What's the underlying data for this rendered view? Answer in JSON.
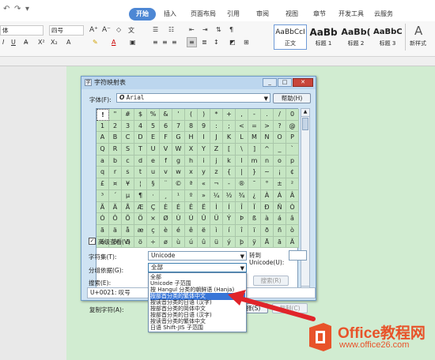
{
  "ribbon": {
    "tabs": [
      {
        "label": "开始",
        "active": true
      },
      {
        "label": "插入"
      },
      {
        "label": "页面布局"
      },
      {
        "label": "引用"
      },
      {
        "label": "审阅"
      },
      {
        "label": "视图"
      },
      {
        "label": "章节"
      },
      {
        "label": "开发工具"
      },
      {
        "label": "云服务"
      }
    ],
    "font_name": "体",
    "font_size": "四号",
    "styles": [
      {
        "preview": "AaBbCcI",
        "label": "正文"
      },
      {
        "preview": "AaBb",
        "label": "标题 1"
      },
      {
        "preview": "AaBb(",
        "label": "标题 2"
      },
      {
        "preview": "AaBbC",
        "label": "标题 3"
      }
    ],
    "new_style_label": "新样式"
  },
  "dialog": {
    "title": "字符映射表",
    "font_label": "字体(F):",
    "font_value": "Arial",
    "help_button": "帮助(H)",
    "characters": [
      "!",
      "\"",
      "#",
      "$",
      "%",
      "&",
      "'",
      "(",
      ")",
      "*",
      "+",
      ",",
      "-",
      ".",
      "/",
      "0",
      "1",
      "2",
      "3",
      "4",
      "5",
      "6",
      "7",
      "8",
      "9",
      ":",
      ";",
      "<",
      "=",
      ">",
      "?",
      "@",
      "A",
      "B",
      "C",
      "D",
      "E",
      "F",
      "G",
      "H",
      "I",
      "J",
      "K",
      "L",
      "M",
      "N",
      "O",
      "P",
      "Q",
      "R",
      "S",
      "T",
      "U",
      "V",
      "W",
      "X",
      "Y",
      "Z",
      "[",
      "\\",
      "]",
      "^",
      "_",
      "`",
      "a",
      "b",
      "c",
      "d",
      "e",
      "f",
      "g",
      "h",
      "i",
      "j",
      "k",
      "l",
      "m",
      "n",
      "o",
      "p",
      "q",
      "r",
      "s",
      "t",
      "u",
      "v",
      "w",
      "x",
      "y",
      "z",
      "{",
      "|",
      "}",
      "~",
      "¡",
      "¢",
      "£",
      "¤",
      "¥",
      "¦",
      "§",
      "¨",
      "©",
      "ª",
      "«",
      "¬",
      "-",
      "®",
      "¯",
      "°",
      "±",
      "²",
      "³",
      "´",
      "µ",
      "¶",
      "·",
      "¸",
      "¹",
      "º",
      "»",
      "¼",
      "½",
      "¾",
      "¿",
      "À",
      "Á",
      "Â",
      "Ã",
      "Ä",
      "Å",
      "Æ",
      "Ç",
      "È",
      "É",
      "Ê",
      "Ë",
      "Ì",
      "Í",
      "Î",
      "Ï",
      "Ð",
      "Ñ",
      "Ò",
      "Ó",
      "Ô",
      "Õ",
      "Ö",
      "×",
      "Ø",
      "Ù",
      "Ú",
      "Û",
      "Ü",
      "Ý",
      "Þ",
      "ß",
      "à",
      "á",
      "â",
      "ã",
      "ä",
      "å",
      "æ",
      "ç",
      "è",
      "é",
      "ê",
      "ë",
      "ì",
      "í",
      "î",
      "ï",
      "ð",
      "ñ",
      "ò",
      "ó",
      "ô",
      "õ",
      "ö",
      "÷",
      "ø",
      "ù",
      "ú",
      "û",
      "ü",
      "ý",
      "þ",
      "ÿ",
      "Ā",
      "ā",
      "Ă"
    ],
    "copy_label": "复制字符(A):",
    "copy_value": "",
    "select_button": "选择(S)",
    "copy_button": "复制(C)",
    "advanced_label": "高级查看(V)",
    "advanced_checked": true,
    "charset_label": "字符集(T):",
    "charset_value": "Unicode",
    "goto_label": "转到 Unicode(U):",
    "groupby_label": "分组依据(G):",
    "groupby_value": "全部",
    "search_label": "搜索(E):",
    "search_button": "搜索(R)",
    "status": "U+0021: 叹号",
    "groupby_options": [
      {
        "label": "全部"
      },
      {
        "label": "Unicode 子范围"
      },
      {
        "label": "按 Hangul 分类的朝鲜语 (Hanja)"
      },
      {
        "label": "按部首分类的繁体中文",
        "highlighted": true
      },
      {
        "label": "按读音分类的日语 (汉字)"
      },
      {
        "label": "按部首分类的简体中文"
      },
      {
        "label": "按部首分类的日语 (汉字)"
      },
      {
        "label": "按读音分类的繁体中文"
      },
      {
        "label": "日语 Shift-JIS 子范围"
      }
    ]
  },
  "watermark": {
    "brand": "Office教程网",
    "url": "www.office26.com"
  },
  "colors": {
    "accent": "#4d87d4",
    "page_bg": "#d1ecd1",
    "arrow": "#e0242a",
    "logo": "#e8532a"
  }
}
